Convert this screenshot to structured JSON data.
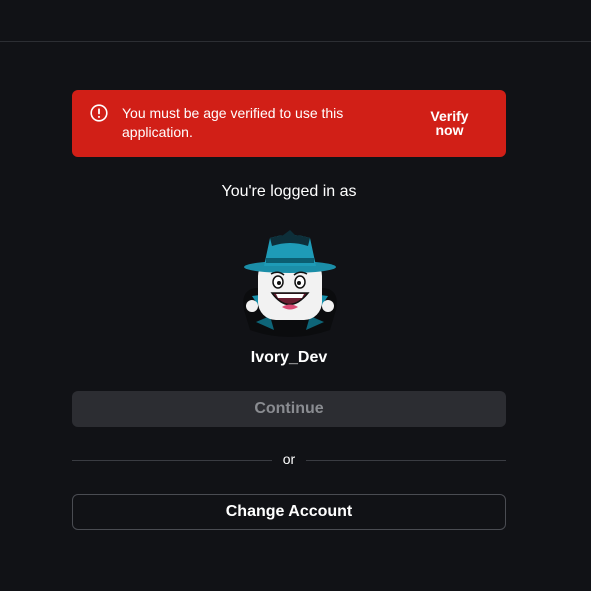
{
  "alert": {
    "message": "You must be age verified to use this application.",
    "action_label": "Verify\nnow",
    "icon": "alert-circle-icon",
    "background_color": "#d11f17"
  },
  "account": {
    "logged_in_label": "You're logged in as",
    "username": "Ivory_Dev",
    "avatar": "avatar-image"
  },
  "actions": {
    "continue_label": "Continue",
    "divider_label": "or",
    "change_account_label": "Change Account"
  },
  "colors": {
    "background": "#111216",
    "continue_button": "#2c2d32",
    "continue_text_disabled": "#8a8c91"
  }
}
